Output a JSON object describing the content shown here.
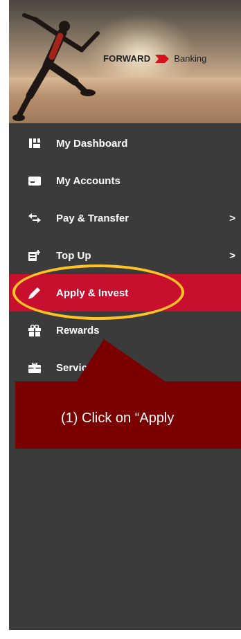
{
  "banner": {
    "brand_left": "FORWARD",
    "brand_right": "Banking"
  },
  "menu": [
    {
      "label": "My Dashboard",
      "icon": "dashboard-icon",
      "chevron": false
    },
    {
      "label": "My Accounts",
      "icon": "card-icon",
      "chevron": false
    },
    {
      "label": "Pay & Transfer",
      "icon": "transfer-icon",
      "chevron": true
    },
    {
      "label": "Top Up",
      "icon": "topup-icon",
      "chevron": true
    },
    {
      "label": "Apply & Invest",
      "icon": "pencil-icon",
      "chevron": false,
      "active": true
    },
    {
      "label": "Rewards",
      "icon": "gift-icon",
      "chevron": false
    },
    {
      "label": "Services",
      "icon": "briefcase-icon",
      "chevron": false
    }
  ],
  "chevron_glyph": ">",
  "callout": {
    "text": "(1) Click on “Apply"
  },
  "colors": {
    "panel": "#3b3b3b",
    "active": "#c8102e",
    "highlight_ring": "#ffc324",
    "callout": "#7a0000",
    "brand_flag": "#d3151b"
  }
}
